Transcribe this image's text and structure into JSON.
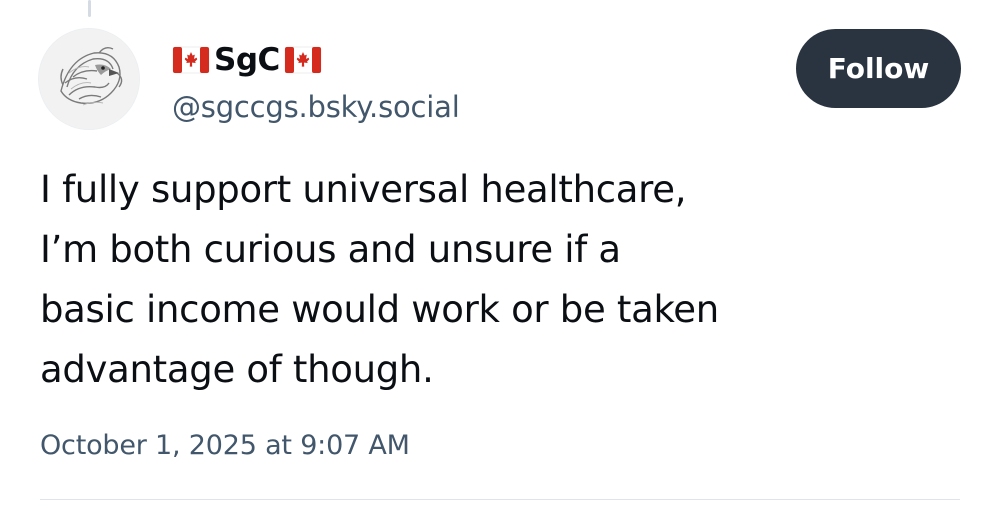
{
  "author": {
    "display_name": "SgC",
    "flag_left": "canada-flag-icon",
    "flag_right": "canada-flag-icon",
    "handle": "@sgccgs.bsky.social",
    "avatar": "eagle-avatar"
  },
  "follow_button": {
    "label": "Follow"
  },
  "post": {
    "text_lines": [
      "I fully support universal healthcare,",
      "I’m both curious and unsure if a",
      "basic income would work or be taken",
      "advantage of though."
    ],
    "timestamp": "October 1, 2025 at 9:07 AM"
  },
  "colors": {
    "button_bg": "#2a3440",
    "secondary_text": "#42576c",
    "flag_red": "#d52b1e"
  }
}
